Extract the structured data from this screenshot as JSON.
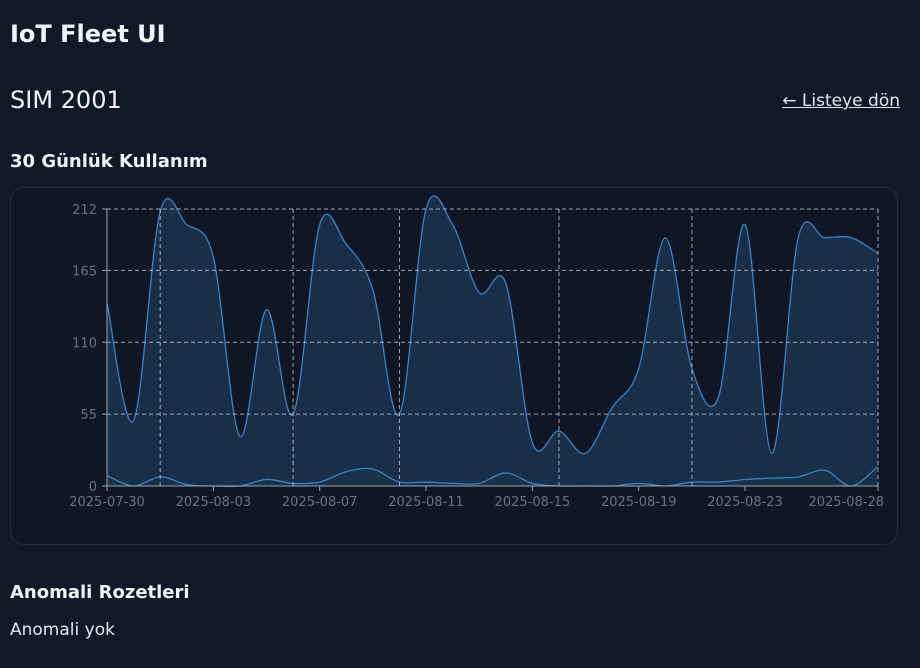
{
  "app": {
    "title": "IoT Fleet UI"
  },
  "page": {
    "title": "SIM 2001",
    "back_link": "← Listeye dön"
  },
  "usage": {
    "title": "30 Günlük Kullanım"
  },
  "anomalies": {
    "title": "Anomali Rozetleri",
    "empty_text": "Anomali yok"
  },
  "colors": {
    "background": "#111827",
    "card": "#0f1726",
    "line": "#3b82c4",
    "fill": "#1b3350",
    "grid": "#cbd5e1",
    "tick": "#6b7280"
  },
  "chart_data": {
    "type": "area",
    "x": [
      "2025-07-30",
      "2025-07-31",
      "2025-08-01",
      "2025-08-02",
      "2025-08-03",
      "2025-08-04",
      "2025-08-05",
      "2025-08-06",
      "2025-08-07",
      "2025-08-08",
      "2025-08-09",
      "2025-08-10",
      "2025-08-11",
      "2025-08-12",
      "2025-08-13",
      "2025-08-14",
      "2025-08-15",
      "2025-08-16",
      "2025-08-17",
      "2025-08-18",
      "2025-08-19",
      "2025-08-20",
      "2025-08-21",
      "2025-08-22",
      "2025-08-23",
      "2025-08-24",
      "2025-08-25",
      "2025-08-26",
      "2025-08-27",
      "2025-08-28"
    ],
    "x_ticks": [
      "2025-07-30",
      "2025-08-03",
      "2025-08-07",
      "2025-08-11",
      "2025-08-15",
      "2025-08-19",
      "2025-08-23",
      "2025-08-28"
    ],
    "series": [
      {
        "values": [
          140,
          50,
          210,
          200,
          175,
          38,
          135,
          55,
          200,
          185,
          150,
          55,
          212,
          200,
          148,
          155,
          33,
          42,
          25,
          60,
          90,
          190,
          90,
          68,
          200,
          25,
          190,
          190,
          190,
          178
        ]
      },
      {
        "values": [
          8,
          0,
          7,
          1,
          0,
          0,
          5,
          2,
          3,
          11,
          13,
          3,
          3,
          2,
          2,
          10,
          2,
          0,
          0,
          0,
          2,
          0,
          3,
          3,
          5,
          6,
          7,
          12,
          0,
          15
        ]
      }
    ],
    "ylim": [
      0,
      212
    ],
    "y_ticks": [
      0,
      55,
      110,
      165,
      212
    ],
    "grid_dates": [
      "2025-08-01",
      "2025-08-06",
      "2025-08-10",
      "2025-08-16",
      "2025-08-21"
    ],
    "grid": true
  }
}
